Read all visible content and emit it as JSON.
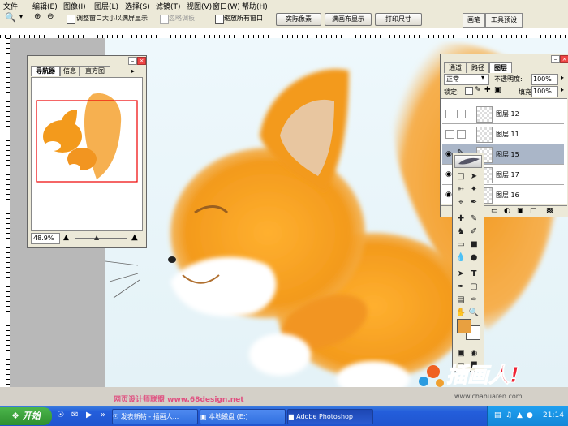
{
  "menu": [
    "文件",
    "编辑(E)",
    "图像(I)",
    "图层(L)",
    "选择(S)",
    "滤镜(T)",
    "视图(V)",
    "窗口(W)",
    "帮助(H)"
  ],
  "options": {
    "resize_label": "调整窗口大小以满屏显示",
    "ignore_label": "忽略调板",
    "zoom_all_label": "缩放所有窗口",
    "actual_pixels": "实际像素",
    "fit_screen": "满画布显示",
    "print_size": "打印尺寸",
    "brushes_tab": "画笔",
    "presets_tab": "工具预设"
  },
  "navigator": {
    "tabs": [
      "导航器",
      "信息",
      "直方图"
    ],
    "zoom": "48.9%"
  },
  "layers": {
    "tabs": [
      "通道",
      "路径",
      "图层"
    ],
    "blend_mode": "正常",
    "opacity_label": "不透明度:",
    "opacity": "100%",
    "lock_label": "锁定:",
    "fill_label": "填充:",
    "fill": "100%",
    "items": [
      {
        "name": "图层 12"
      },
      {
        "name": "图层 11"
      },
      {
        "name": "图层 15"
      },
      {
        "name": "图层 17"
      },
      {
        "name": "图层 16"
      }
    ]
  },
  "watermark": {
    "left": "网页设计师联盟  www.68design.net",
    "logo": "插画人!",
    "url": "www.chahuaren.com"
  },
  "taskbar": {
    "start": "开始",
    "tasks": [
      "发表新帖 - 插画人...",
      "本地磁盘 (E:)",
      "Adobe Photoshop"
    ],
    "time": "21:14"
  },
  "colors": {
    "accent": "#245edb",
    "fox": "#f0a020",
    "fg_swatch": "#e8a040"
  }
}
